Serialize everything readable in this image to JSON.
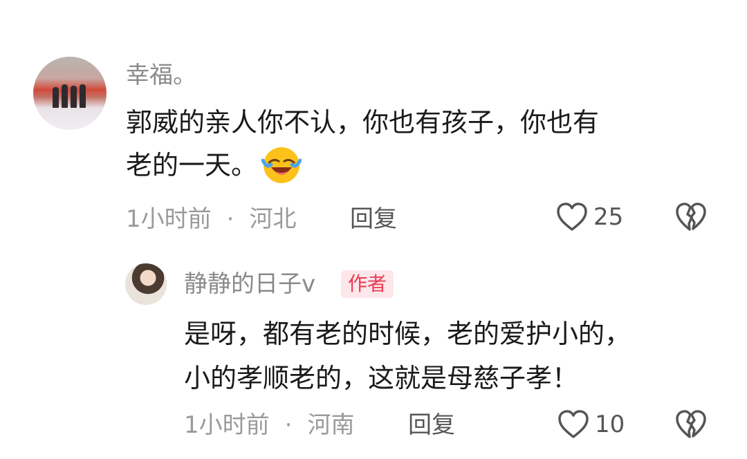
{
  "comments": [
    {
      "username": "幸福。",
      "text_line1": "郭威的亲人你不认，你也有孩子，你也有",
      "text_line2": "老的一天。",
      "time": "1小时前",
      "separator": "·",
      "location": "河北",
      "reply_label": "回复",
      "likes": "25"
    },
    {
      "username": "静静的日子v",
      "badge": "作者",
      "text_line1": "是呀，都有老的时候，老的爱护小的，",
      "text_line2": "小的孝顺老的，这就是母慈子孝！",
      "time": "1小时前",
      "separator": "·",
      "location": "河南",
      "reply_label": "回复",
      "likes": "10"
    }
  ],
  "icons": {
    "like": "heart-outline-icon",
    "dislike": "broken-heart-icon",
    "emoji": "laughing-crying-emoji-icon"
  },
  "colors": {
    "author_badge_bg": "#fde7ea",
    "author_badge_text": "#ea3b55"
  }
}
